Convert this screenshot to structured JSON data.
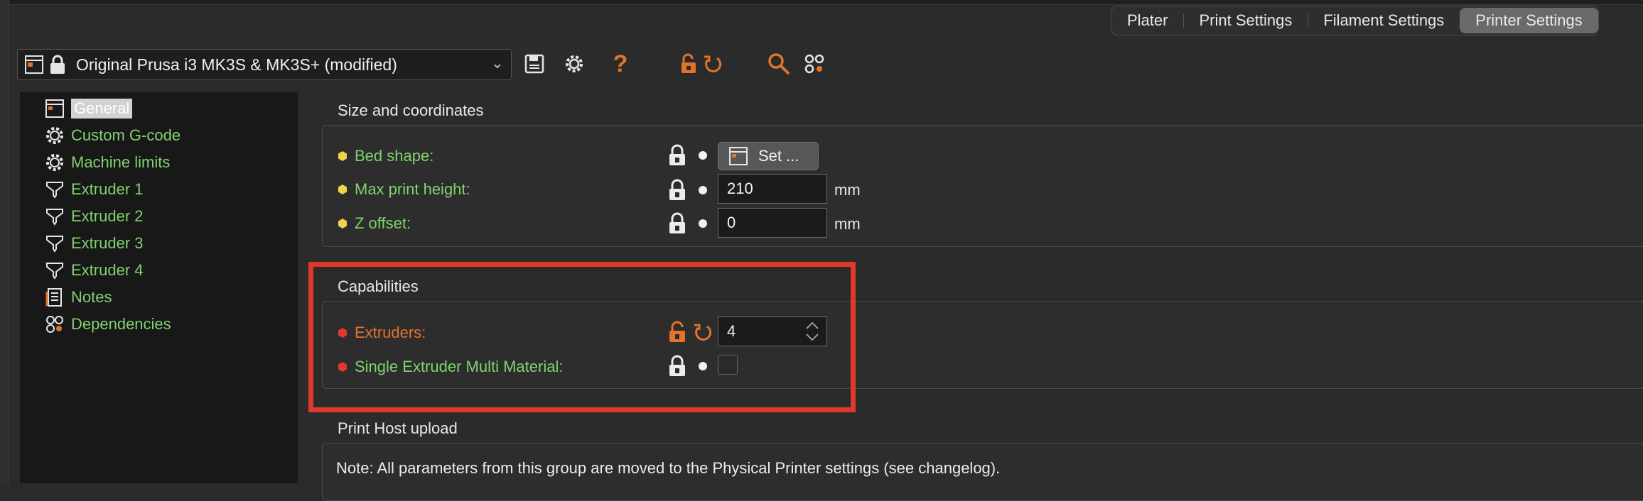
{
  "tabs": [
    "Plater",
    "Print Settings",
    "Filament Settings",
    "Printer Settings"
  ],
  "active_tab": "Printer Settings",
  "preset": {
    "value": "Original Prusa i3 MK3S & MK3S+ (modified)"
  },
  "toolbar_icons": [
    "save-icon",
    "cog-icon",
    "help-icon",
    "unlock-icon",
    "undo-icon",
    "search-icon",
    "compare-icon"
  ],
  "sidebar": {
    "items": [
      {
        "label": "General",
        "icon": "printer-icon",
        "selected": true
      },
      {
        "label": "Custom G-code",
        "icon": "cog-icon"
      },
      {
        "label": "Machine limits",
        "icon": "cog-icon"
      },
      {
        "label": "Extruder 1",
        "icon": "extruder-icon"
      },
      {
        "label": "Extruder 2",
        "icon": "extruder-icon"
      },
      {
        "label": "Extruder 3",
        "icon": "extruder-icon"
      },
      {
        "label": "Extruder 4",
        "icon": "extruder-icon"
      },
      {
        "label": "Notes",
        "icon": "notes-icon"
      },
      {
        "label": "Dependencies",
        "icon": "dependencies-icon"
      }
    ]
  },
  "groups": {
    "size": {
      "title": "Size and coordinates",
      "bed_shape": {
        "label": "Bed shape:",
        "button": "Set ..."
      },
      "max_height": {
        "label": "Max print height:",
        "value": "210",
        "unit": "mm"
      },
      "z_offset": {
        "label": "Z offset:",
        "value": "0",
        "unit": "mm"
      }
    },
    "capabilities": {
      "title": "Capabilities",
      "extruders": {
        "label": "Extruders:",
        "value": "4"
      },
      "semm": {
        "label": "Single Extruder Multi Material:",
        "checked": false
      }
    },
    "host": {
      "title": "Print Host upload",
      "note": "Note: All parameters from this group are moved to the Physical Printer settings (see changelog)."
    }
  },
  "colors": {
    "accent_green": "#7fd36e",
    "modified_orange": "#e0742b",
    "highlight_red": "#e0392b",
    "dot_yellow": "#f0d34a",
    "dot_red": "#e03a2b"
  }
}
